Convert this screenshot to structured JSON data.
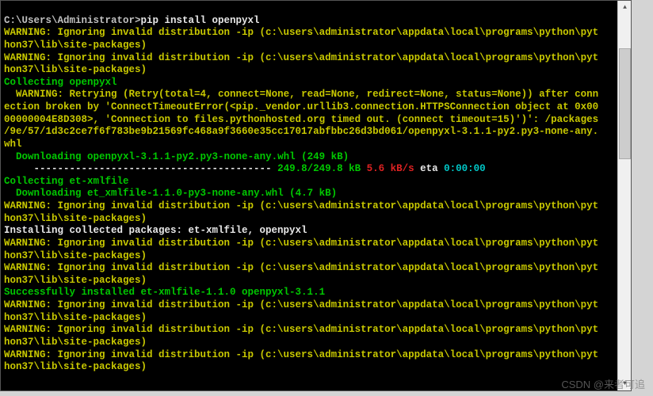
{
  "prompt": {
    "path": "C:\\Users\\Administrator>",
    "command": "pip install openpyxl"
  },
  "warnings": {
    "invalid_dist_line1": "WARNING: Ignoring invalid distribution -ip (c:\\users\\administrator\\appdata\\local\\programs\\python\\pyt",
    "invalid_dist_line2": "hon37\\lib\\site-packages)"
  },
  "collecting": {
    "openpyxl": "Collecting openpyxl",
    "etxmlfile": "Collecting et-xmlfile"
  },
  "retry": {
    "line1": "  WARNING: Retrying (Retry(total=4, connect=None, read=None, redirect=None, status=None)) after conn",
    "line2": "ection broken by 'ConnectTimeoutError(<pip._vendor.urllib3.connection.HTTPSConnection object at 0x00",
    "line3": "00000004E8D308>, 'Connection to files.pythonhosted.org timed out. (connect timeout=15)')': /packages",
    "line4": "/9e/57/1d3c2ce7f6f783be9b21569fc468a9f3660e35cc17017abfbbc26d3bd061/openpyxl-3.1.1-py2.py3-none-any.",
    "line5": "whl"
  },
  "downloads": {
    "openpyxl": "  Downloading openpyxl-3.1.1-py2.py3-none-any.whl (249 kB)",
    "etxmlfile": "  Downloading et_xmlfile-1.1.0-py3-none-any.whl (4.7 kB)"
  },
  "progress": {
    "bar": "     ---------------------------------------- ",
    "done": "249.8/249.8 kB",
    "speed": " 5.6 kB/s",
    "eta_label": " eta ",
    "eta_value": "0:00:00"
  },
  "install": {
    "collected": "Installing collected packages: et-xmlfile, openpyxl",
    "success": "Successfully installed et-xmlfile-1.1.0 openpyxl-3.1.1"
  },
  "watermark": "CSDN @来者可追"
}
